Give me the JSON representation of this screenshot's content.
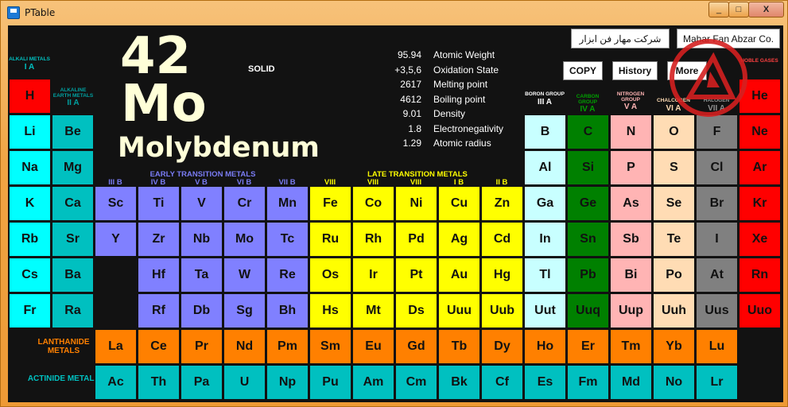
{
  "window": {
    "title": "PTable",
    "minimize_glyph": "_",
    "maximize_glyph": "□",
    "close_glyph": "X"
  },
  "selected": {
    "number": "42",
    "symbol": "Mo",
    "name": "Molybdenum",
    "state": "SOLID"
  },
  "properties": [
    {
      "value": "95.94",
      "label": "Atomic Weight"
    },
    {
      "value": "+3,5,6",
      "label": "Oxidation State"
    },
    {
      "value": "2617",
      "label": "Melting point"
    },
    {
      "value": "4612",
      "label": "Boiling point"
    },
    {
      "value": "9.01",
      "label": "Density"
    },
    {
      "value": "1.8",
      "label": "Electronegativity"
    },
    {
      "value": "1.29",
      "label": "Atomic radius"
    }
  ],
  "company": {
    "persian": "شرکت مهار فن ابزار",
    "english": "Mahar Fan Abzar Co."
  },
  "buttons": {
    "copy": "COPY",
    "history": "History",
    "more": "More"
  },
  "colors": {
    "alkali": "#fe0000",
    "alkaline": "#00c0c0",
    "hydrogen_like": "#00ffff",
    "early_tm": "#8080ff",
    "late_tm": "#ffff00",
    "boron": "#c8ffff",
    "carbon": "#008000",
    "nitrogen": "#ffb4b4",
    "chalcogen": "#ffdcb4",
    "halogen": "#808080",
    "noble": "#ff0000",
    "lanthanide": "#ff8000",
    "actinide": "#00c0c0"
  },
  "groups": {
    "g1": {
      "name": "ALKALI METALS",
      "roman": "I A",
      "color": "#00c0c0"
    },
    "g2": {
      "name": "ALKALINE EARTH METALS",
      "roman": "II A",
      "color": "#00a0a0"
    },
    "g13": {
      "name": "BORON GROUP",
      "roman": "III A",
      "color": "#ffffff"
    },
    "g14": {
      "name": "CARBON GROUP",
      "roman": "IV A",
      "color": "#00a000"
    },
    "g15": {
      "name": "NITROGEN GROUP",
      "roman": "V A",
      "color": "#ffb4b4"
    },
    "g16": {
      "name": "CHALCOGEN",
      "roman": "VI A",
      "color": "#ffdcb4"
    },
    "g17": {
      "name": "HALOGEN",
      "roman": "VII A",
      "color": "#909090"
    },
    "g18": {
      "name": "NOBLE GASES",
      "roman": "",
      "color": "#ff4040"
    }
  },
  "bands": {
    "early": "EARLY TRANSITION METALS",
    "late": "LATE TRANSITION METALS"
  },
  "transition_labels": [
    "III B",
    "IV B",
    "V B",
    "VI B",
    "VII B",
    "VIII",
    "VIII",
    "VIII",
    "I B",
    "II B"
  ],
  "series": {
    "lanthanide": "LANTHANIDE METALS",
    "actinide": "ACTINIDE METALS"
  },
  "elements": [
    {
      "s": "H",
      "c": 1,
      "r": 1,
      "cat": "alkali"
    },
    {
      "s": "He",
      "c": 18,
      "r": 1,
      "cat": "noble"
    },
    {
      "s": "Li",
      "c": 1,
      "r": 2,
      "cat": "hydrogen_like"
    },
    {
      "s": "Be",
      "c": 2,
      "r": 2,
      "cat": "alkaline"
    },
    {
      "s": "B",
      "c": 13,
      "r": 2,
      "cat": "boron"
    },
    {
      "s": "C",
      "c": 14,
      "r": 2,
      "cat": "carbon"
    },
    {
      "s": "N",
      "c": 15,
      "r": 2,
      "cat": "nitrogen"
    },
    {
      "s": "O",
      "c": 16,
      "r": 2,
      "cat": "chalcogen"
    },
    {
      "s": "F",
      "c": 17,
      "r": 2,
      "cat": "halogen"
    },
    {
      "s": "Ne",
      "c": 18,
      "r": 2,
      "cat": "noble"
    },
    {
      "s": "Na",
      "c": 1,
      "r": 3,
      "cat": "hydrogen_like"
    },
    {
      "s": "Mg",
      "c": 2,
      "r": 3,
      "cat": "alkaline"
    },
    {
      "s": "Al",
      "c": 13,
      "r": 3,
      "cat": "boron"
    },
    {
      "s": "Si",
      "c": 14,
      "r": 3,
      "cat": "carbon"
    },
    {
      "s": "P",
      "c": 15,
      "r": 3,
      "cat": "nitrogen"
    },
    {
      "s": "S",
      "c": 16,
      "r": 3,
      "cat": "chalcogen"
    },
    {
      "s": "Cl",
      "c": 17,
      "r": 3,
      "cat": "halogen"
    },
    {
      "s": "Ar",
      "c": 18,
      "r": 3,
      "cat": "noble"
    },
    {
      "s": "K",
      "c": 1,
      "r": 4,
      "cat": "hydrogen_like"
    },
    {
      "s": "Ca",
      "c": 2,
      "r": 4,
      "cat": "alkaline"
    },
    {
      "s": "Sc",
      "c": 3,
      "r": 4,
      "cat": "early_tm"
    },
    {
      "s": "Ti",
      "c": 4,
      "r": 4,
      "cat": "early_tm"
    },
    {
      "s": "V",
      "c": 5,
      "r": 4,
      "cat": "early_tm"
    },
    {
      "s": "Cr",
      "c": 6,
      "r": 4,
      "cat": "early_tm"
    },
    {
      "s": "Mn",
      "c": 7,
      "r": 4,
      "cat": "early_tm"
    },
    {
      "s": "Fe",
      "c": 8,
      "r": 4,
      "cat": "late_tm"
    },
    {
      "s": "Co",
      "c": 9,
      "r": 4,
      "cat": "late_tm"
    },
    {
      "s": "Ni",
      "c": 10,
      "r": 4,
      "cat": "late_tm"
    },
    {
      "s": "Cu",
      "c": 11,
      "r": 4,
      "cat": "late_tm"
    },
    {
      "s": "Zn",
      "c": 12,
      "r": 4,
      "cat": "late_tm"
    },
    {
      "s": "Ga",
      "c": 13,
      "r": 4,
      "cat": "boron"
    },
    {
      "s": "Ge",
      "c": 14,
      "r": 4,
      "cat": "carbon"
    },
    {
      "s": "As",
      "c": 15,
      "r": 4,
      "cat": "nitrogen"
    },
    {
      "s": "Se",
      "c": 16,
      "r": 4,
      "cat": "chalcogen"
    },
    {
      "s": "Br",
      "c": 17,
      "r": 4,
      "cat": "halogen"
    },
    {
      "s": "Kr",
      "c": 18,
      "r": 4,
      "cat": "noble"
    },
    {
      "s": "Rb",
      "c": 1,
      "r": 5,
      "cat": "hydrogen_like"
    },
    {
      "s": "Sr",
      "c": 2,
      "r": 5,
      "cat": "alkaline"
    },
    {
      "s": "Y",
      "c": 3,
      "r": 5,
      "cat": "early_tm"
    },
    {
      "s": "Zr",
      "c": 4,
      "r": 5,
      "cat": "early_tm"
    },
    {
      "s": "Nb",
      "c": 5,
      "r": 5,
      "cat": "early_tm"
    },
    {
      "s": "Mo",
      "c": 6,
      "r": 5,
      "cat": "early_tm"
    },
    {
      "s": "Tc",
      "c": 7,
      "r": 5,
      "cat": "early_tm"
    },
    {
      "s": "Ru",
      "c": 8,
      "r": 5,
      "cat": "late_tm"
    },
    {
      "s": "Rh",
      "c": 9,
      "r": 5,
      "cat": "late_tm"
    },
    {
      "s": "Pd",
      "c": 10,
      "r": 5,
      "cat": "late_tm"
    },
    {
      "s": "Ag",
      "c": 11,
      "r": 5,
      "cat": "late_tm"
    },
    {
      "s": "Cd",
      "c": 12,
      "r": 5,
      "cat": "late_tm"
    },
    {
      "s": "In",
      "c": 13,
      "r": 5,
      "cat": "boron"
    },
    {
      "s": "Sn",
      "c": 14,
      "r": 5,
      "cat": "carbon"
    },
    {
      "s": "Sb",
      "c": 15,
      "r": 5,
      "cat": "nitrogen"
    },
    {
      "s": "Te",
      "c": 16,
      "r": 5,
      "cat": "chalcogen"
    },
    {
      "s": "I",
      "c": 17,
      "r": 5,
      "cat": "halogen"
    },
    {
      "s": "Xe",
      "c": 18,
      "r": 5,
      "cat": "noble"
    },
    {
      "s": "Cs",
      "c": 1,
      "r": 6,
      "cat": "hydrogen_like"
    },
    {
      "s": "Ba",
      "c": 2,
      "r": 6,
      "cat": "alkaline"
    },
    {
      "s": "Hf",
      "c": 4,
      "r": 6,
      "cat": "early_tm"
    },
    {
      "s": "Ta",
      "c": 5,
      "r": 6,
      "cat": "early_tm"
    },
    {
      "s": "W",
      "c": 6,
      "r": 6,
      "cat": "early_tm"
    },
    {
      "s": "Re",
      "c": 7,
      "r": 6,
      "cat": "early_tm"
    },
    {
      "s": "Os",
      "c": 8,
      "r": 6,
      "cat": "late_tm"
    },
    {
      "s": "Ir",
      "c": 9,
      "r": 6,
      "cat": "late_tm"
    },
    {
      "s": "Pt",
      "c": 10,
      "r": 6,
      "cat": "late_tm"
    },
    {
      "s": "Au",
      "c": 11,
      "r": 6,
      "cat": "late_tm"
    },
    {
      "s": "Hg",
      "c": 12,
      "r": 6,
      "cat": "late_tm"
    },
    {
      "s": "Tl",
      "c": 13,
      "r": 6,
      "cat": "boron"
    },
    {
      "s": "Pb",
      "c": 14,
      "r": 6,
      "cat": "carbon"
    },
    {
      "s": "Bi",
      "c": 15,
      "r": 6,
      "cat": "nitrogen"
    },
    {
      "s": "Po",
      "c": 16,
      "r": 6,
      "cat": "chalcogen"
    },
    {
      "s": "At",
      "c": 17,
      "r": 6,
      "cat": "halogen"
    },
    {
      "s": "Rn",
      "c": 18,
      "r": 6,
      "cat": "noble"
    },
    {
      "s": "Fr",
      "c": 1,
      "r": 7,
      "cat": "hydrogen_like"
    },
    {
      "s": "Ra",
      "c": 2,
      "r": 7,
      "cat": "alkaline"
    },
    {
      "s": "Rf",
      "c": 4,
      "r": 7,
      "cat": "early_tm"
    },
    {
      "s": "Db",
      "c": 5,
      "r": 7,
      "cat": "early_tm"
    },
    {
      "s": "Sg",
      "c": 6,
      "r": 7,
      "cat": "early_tm"
    },
    {
      "s": "Bh",
      "c": 7,
      "r": 7,
      "cat": "early_tm"
    },
    {
      "s": "Hs",
      "c": 8,
      "r": 7,
      "cat": "late_tm"
    },
    {
      "s": "Mt",
      "c": 9,
      "r": 7,
      "cat": "late_tm"
    },
    {
      "s": "Ds",
      "c": 10,
      "r": 7,
      "cat": "late_tm"
    },
    {
      "s": "Uuu",
      "c": 11,
      "r": 7,
      "cat": "late_tm"
    },
    {
      "s": "Uub",
      "c": 12,
      "r": 7,
      "cat": "late_tm"
    },
    {
      "s": "Uut",
      "c": 13,
      "r": 7,
      "cat": "boron"
    },
    {
      "s": "Uuq",
      "c": 14,
      "r": 7,
      "cat": "carbon"
    },
    {
      "s": "Uup",
      "c": 15,
      "r": 7,
      "cat": "nitrogen"
    },
    {
      "s": "Uuh",
      "c": 16,
      "r": 7,
      "cat": "chalcogen"
    },
    {
      "s": "Uus",
      "c": 17,
      "r": 7,
      "cat": "halogen"
    },
    {
      "s": "Uuo",
      "c": 18,
      "r": 7,
      "cat": "noble"
    },
    {
      "s": "La",
      "c": 3,
      "r": 8,
      "cat": "lanthanide"
    },
    {
      "s": "Ce",
      "c": 4,
      "r": 8,
      "cat": "lanthanide"
    },
    {
      "s": "Pr",
      "c": 5,
      "r": 8,
      "cat": "lanthanide"
    },
    {
      "s": "Nd",
      "c": 6,
      "r": 8,
      "cat": "lanthanide"
    },
    {
      "s": "Pm",
      "c": 7,
      "r": 8,
      "cat": "lanthanide"
    },
    {
      "s": "Sm",
      "c": 8,
      "r": 8,
      "cat": "lanthanide"
    },
    {
      "s": "Eu",
      "c": 9,
      "r": 8,
      "cat": "lanthanide"
    },
    {
      "s": "Gd",
      "c": 10,
      "r": 8,
      "cat": "lanthanide"
    },
    {
      "s": "Tb",
      "c": 11,
      "r": 8,
      "cat": "lanthanide"
    },
    {
      "s": "Dy",
      "c": 12,
      "r": 8,
      "cat": "lanthanide"
    },
    {
      "s": "Ho",
      "c": 13,
      "r": 8,
      "cat": "lanthanide"
    },
    {
      "s": "Er",
      "c": 14,
      "r": 8,
      "cat": "lanthanide"
    },
    {
      "s": "Tm",
      "c": 15,
      "r": 8,
      "cat": "lanthanide"
    },
    {
      "s": "Yb",
      "c": 16,
      "r": 8,
      "cat": "lanthanide"
    },
    {
      "s": "Lu",
      "c": 17,
      "r": 8,
      "cat": "lanthanide"
    },
    {
      "s": "Ac",
      "c": 3,
      "r": 9,
      "cat": "actinide"
    },
    {
      "s": "Th",
      "c": 4,
      "r": 9,
      "cat": "actinide"
    },
    {
      "s": "Pa",
      "c": 5,
      "r": 9,
      "cat": "actinide"
    },
    {
      "s": "U",
      "c": 6,
      "r": 9,
      "cat": "actinide"
    },
    {
      "s": "Np",
      "c": 7,
      "r": 9,
      "cat": "actinide"
    },
    {
      "s": "Pu",
      "c": 8,
      "r": 9,
      "cat": "actinide"
    },
    {
      "s": "Am",
      "c": 9,
      "r": 9,
      "cat": "actinide"
    },
    {
      "s": "Cm",
      "c": 10,
      "r": 9,
      "cat": "actinide"
    },
    {
      "s": "Bk",
      "c": 11,
      "r": 9,
      "cat": "actinide"
    },
    {
      "s": "Cf",
      "c": 12,
      "r": 9,
      "cat": "actinide"
    },
    {
      "s": "Es",
      "c": 13,
      "r": 9,
      "cat": "actinide"
    },
    {
      "s": "Fm",
      "c": 14,
      "r": 9,
      "cat": "actinide"
    },
    {
      "s": "Md",
      "c": 15,
      "r": 9,
      "cat": "actinide"
    },
    {
      "s": "No",
      "c": 16,
      "r": 9,
      "cat": "actinide"
    },
    {
      "s": "Lr",
      "c": 17,
      "r": 9,
      "cat": "actinide"
    }
  ]
}
